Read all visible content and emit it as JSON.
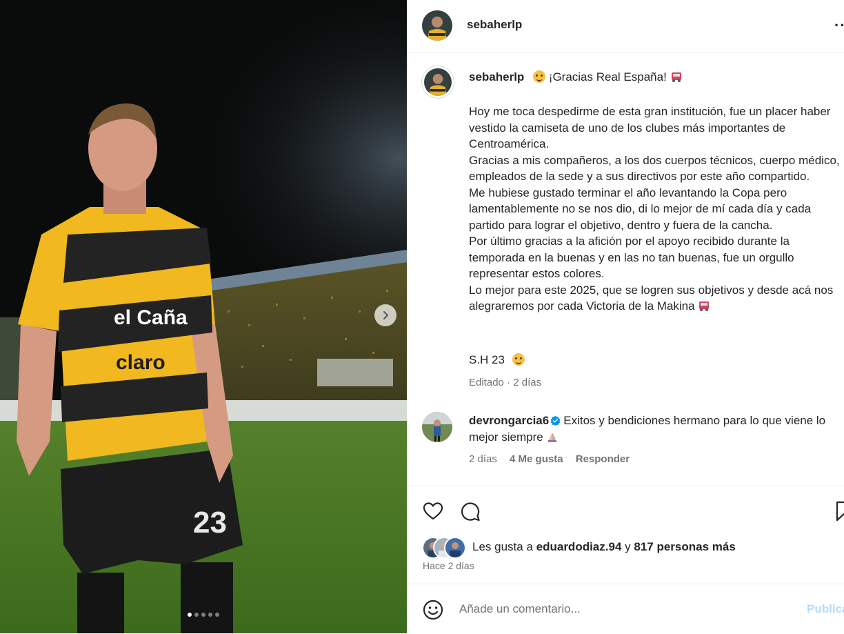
{
  "post": {
    "username": "sebaherlp",
    "more_icon": "more-horizontal-icon",
    "media": {
      "carousel_total": 5,
      "carousel_active": 1,
      "next_icon": "chevron-right-icon"
    }
  },
  "caption": {
    "username": "sebaherlp",
    "title_text": "¡Gracias Real España!",
    "paragraphs": [
      "Hoy me toca despedirme de esta gran institución, fue un placer haber vestido la camiseta de uno de los clubes más importantes de Centroamérica.",
      "Gracias a mis compañeros, a los dos cuerpos técnicos, cuerpo médico, empleados de la sede y a sus directivos por este año compartido.",
      "Me hubiese gustado terminar el año levantando la Copa pero lamentablemente no se nos dio, di lo mejor de mí cada día y cada partido para lograr el objetivo, dentro y fuera de la cancha.",
      "Por último gracias a la afición por el apoyo recibido durante la temporada en la buenas y en las no tan buenas, fue un orgullo representar estos colores.",
      "Lo mejor para este 2025, que se logren sus objetivos y desde acá nos alegraremos por cada Victoria de la Makina"
    ],
    "signature": "S.H 23",
    "edited": "Editado",
    "edited_time": "2 días"
  },
  "comment": {
    "username": "devrongarcia6",
    "verified": true,
    "text": "Exitos y bendiciones hermano para lo que viene lo mejor siempre",
    "time": "2 días",
    "likes": "4 Me gusta",
    "reply_label": "Responder"
  },
  "actions": {
    "like_icon": "heart-icon",
    "comment_icon": "comment-icon",
    "save_icon": "bookmark-icon"
  },
  "likes": {
    "prefix": "Les gusta a",
    "first_liker": "eduardodiaz.94",
    "connector": "y",
    "others": "817 personas más"
  },
  "post_time": "Hace 2 días",
  "add_comment": {
    "emoji_icon": "smiley-icon",
    "placeholder": "Añade un comentario...",
    "publish_label": "Publicar"
  },
  "colors": {
    "text": "#262626",
    "secondary": "#737373",
    "publish_disabled": "#b3dbff",
    "verified": "#0095f6",
    "jersey_yellow": "#f1b81f"
  }
}
